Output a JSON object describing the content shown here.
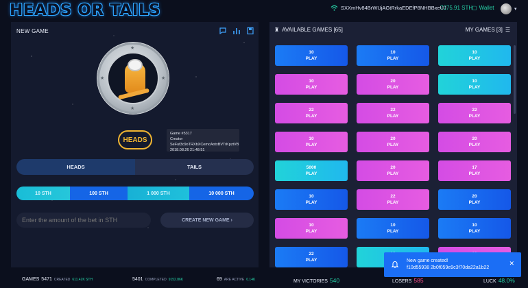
{
  "header": {
    "logo": "HEADS OR TAILS",
    "wallet_address": "SXXmHv84BrWUjAGtRrkaEDEfP8NHBBxeUJ",
    "balance": "7275.91 STH",
    "wallet_label": "Wallet"
  },
  "new_game": {
    "title": "NEW GAME",
    "selected_side": "HEADS",
    "tooltip": {
      "line1": "Game #5317",
      "line2": "Creator SeFut3c9oTRXbXCemcAotxBVTrKpztVB",
      "line3": "2018.08.26 21:48:51"
    },
    "side_options": [
      "HEADS",
      "TAILS"
    ],
    "amount_options": [
      "10 STH",
      "100 STH",
      "1 000 STH",
      "10 000 STH"
    ],
    "bet_placeholder": "Enter the amount of the bet in STH",
    "create_label": "CREATE NEW GAME"
  },
  "available_games": {
    "label": "AVAILABLE GAMES [65]",
    "my_games_label": "MY GAMES [3]",
    "tiles": [
      {
        "amount": "10",
        "action": "PLAY",
        "color": "blue"
      },
      {
        "amount": "10",
        "action": "PLAY",
        "color": "blue"
      },
      {
        "amount": "10",
        "action": "PLAY",
        "color": "cyan"
      },
      {
        "amount": "10",
        "action": "PLAY",
        "color": "pink"
      },
      {
        "amount": "20",
        "action": "PLAY",
        "color": "pink"
      },
      {
        "amount": "10",
        "action": "PLAY",
        "color": "cyan"
      },
      {
        "amount": "22",
        "action": "PLAY",
        "color": "pink"
      },
      {
        "amount": "22",
        "action": "PLAY",
        "color": "pink"
      },
      {
        "amount": "22",
        "action": "PLAY",
        "color": "pink"
      },
      {
        "amount": "10",
        "action": "PLAY",
        "color": "pink"
      },
      {
        "amount": "20",
        "action": "PLAY",
        "color": "pink"
      },
      {
        "amount": "20",
        "action": "PLAY",
        "color": "pink"
      },
      {
        "amount": "5000",
        "action": "PLAY",
        "color": "cyan"
      },
      {
        "amount": "20",
        "action": "PLAY",
        "color": "pink"
      },
      {
        "amount": "17",
        "action": "PLAY",
        "color": "pink"
      },
      {
        "amount": "10",
        "action": "PLAY",
        "color": "blue"
      },
      {
        "amount": "22",
        "action": "PLAY",
        "color": "pink"
      },
      {
        "amount": "20",
        "action": "PLAY",
        "color": "blue"
      },
      {
        "amount": "10",
        "action": "PLAY",
        "color": "pink"
      },
      {
        "amount": "10",
        "action": "PLAY",
        "color": "blue"
      },
      {
        "amount": "10",
        "action": "PLAY",
        "color": "blue"
      },
      {
        "amount": "22",
        "action": "PLAY",
        "color": "blue"
      },
      {
        "amount": "10",
        "action": "PLAY",
        "color": "cyan"
      },
      {
        "amount": "10",
        "action": "PLAY",
        "color": "pink"
      }
    ]
  },
  "stats": {
    "games_label": "GAMES",
    "games_value": "5471",
    "created_label": "CREATED",
    "created_value": "611.42K STH",
    "completed_value": "5401",
    "completed_label": "COMPLETED",
    "completed_amount": "9152.86K",
    "active_value": "69",
    "active_label": "ARE ACTIVE",
    "active_amount": "0.14K",
    "victories_label": "MY VICTORIES",
    "victories_value": "540",
    "losers_label": "LOSERS",
    "losers_value": "585",
    "luck_label": "LUCK",
    "luck_value": "48.0%"
  },
  "toast": {
    "title": "New game created!",
    "hash": "f10d55938 2b0f059e9c3f70da22a1b22"
  }
}
